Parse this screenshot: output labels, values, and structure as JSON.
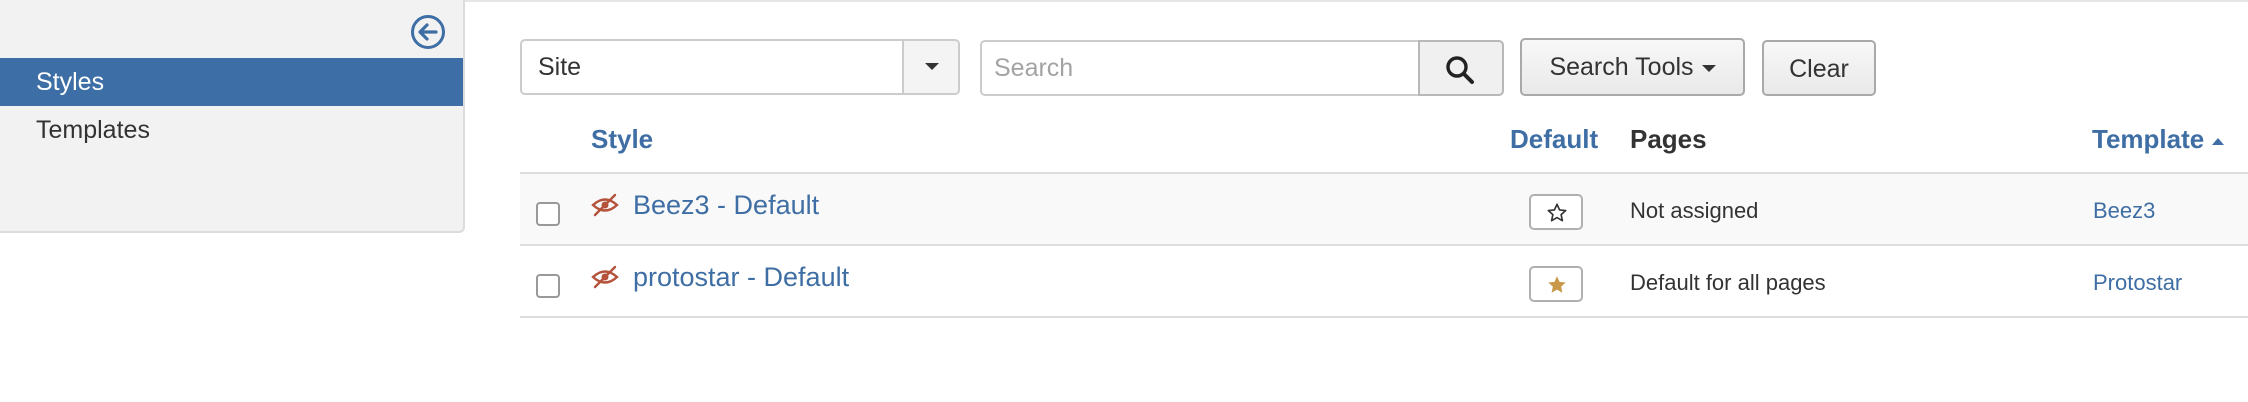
{
  "sidebar": {
    "toggle_icon": "arrow-left-circle-icon",
    "items": [
      {
        "label": "Styles",
        "active": true
      },
      {
        "label": "Templates",
        "active": false
      }
    ]
  },
  "filters": {
    "client_select": {
      "value": "Site"
    },
    "search": {
      "placeholder": "Search",
      "value": ""
    },
    "search_tools_label": "Search Tools",
    "clear_label": "Clear"
  },
  "table": {
    "headers": {
      "style": "Style",
      "default": "Default",
      "pages": "Pages",
      "template": "Template"
    },
    "sort": {
      "column": "Template",
      "direction": "ascending"
    },
    "rows": [
      {
        "title": "Beez3 - Default",
        "default": false,
        "pages": "Not assigned",
        "template": "Beez3"
      },
      {
        "title": "protostar - Default",
        "default": true,
        "pages": "Default for all pages",
        "template": "Protostar"
      }
    ]
  },
  "colors": {
    "accent": "#3d6ea5",
    "link": "#3e6ea4",
    "hidden_eye": "#b5523b",
    "star_default": "#c9994a"
  }
}
